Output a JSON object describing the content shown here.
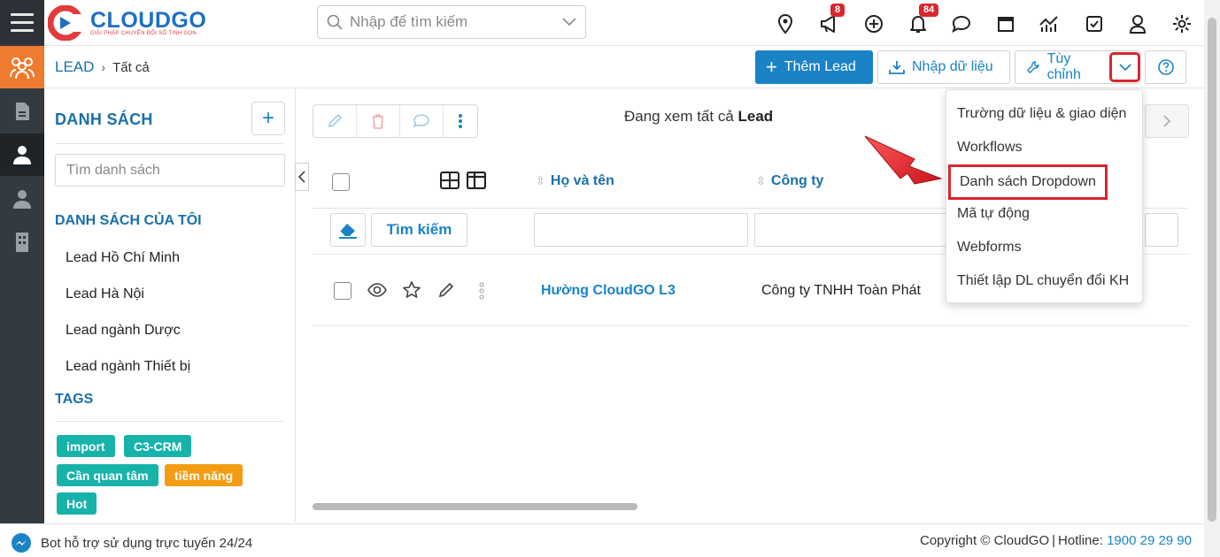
{
  "header": {
    "logo_brand": "CLOUDGO",
    "logo_tagline": "GIẢI PHÁP CHUYỂN ĐỔI SỐ TINH GỌN",
    "search_placeholder": "Nhập để tìm kiếm",
    "icons": [
      "location-icon",
      "megaphone-icon",
      "plus-circle-icon",
      "bell-icon",
      "chat-icon",
      "calendar-icon",
      "report-icon",
      "checkbox-icon",
      "user-icon",
      "gear-icon"
    ],
    "megaphone_badge": "8",
    "bell_badge": "84"
  },
  "breadcrumb": {
    "module": "LEAD",
    "separator": "›",
    "current": "Tất cả"
  },
  "toolbar": {
    "add_label": "Thêm Lead",
    "import_label": "Nhập dữ liệu",
    "customize_label": "Tùy chỉnh"
  },
  "sidebar": {
    "title": "DANH SÁCH",
    "add_symbol": "+",
    "search_placeholder": "Tìm danh sách",
    "my_lists_title": "DANH SÁCH CỦA TÔI",
    "lists": [
      "Lead Hồ Chí Minh",
      "Lead Hà Nội",
      "Lead ngành Dược",
      "Lead ngành Thiết bị"
    ],
    "tags_title": "TAGS",
    "tags": [
      {
        "label": "import",
        "color": "#17b3aa"
      },
      {
        "label": "C3-CRM",
        "color": "#17b3aa"
      },
      {
        "label": "Cần quan tâm",
        "color": "#17b3aa"
      },
      {
        "label": "tiềm năng",
        "color": "#f39c12"
      },
      {
        "label": "Hot",
        "color": "#17b3aa"
      }
    ]
  },
  "main": {
    "viewing_prefix": "Đang xem tất cả",
    "viewing_module": "Lead",
    "columns": [
      "Họ và tên",
      "Công ty"
    ],
    "filter_search_label": "Tìm kiếm",
    "rows": [
      {
        "name": "Hường CloudGO L3",
        "company": "Công ty TNHH Toàn Phát"
      }
    ]
  },
  "dropdown_menu": {
    "items": [
      "Trường dữ liệu & giao diện",
      "Workflows",
      "Danh sách Dropdown",
      "Mã tự động",
      "Webforms",
      "Thiết lập DL chuyển đổi KH"
    ],
    "highlighted_item": "Danh sách Dropdown"
  },
  "footer": {
    "chat_text": "Bot hỗ trợ sử dụng trực tuyến 24/24",
    "copyright": "Copyright © CloudGO",
    "hotline_label": "Hotline:",
    "hotline_number": "1900 29 29 90"
  },
  "colors": {
    "primary": "#1a83c6",
    "link": "#1a6fa8",
    "accent_orange": "#ef7b2f",
    "highlight_red": "#d7262f",
    "rail_dark": "#333a40"
  }
}
